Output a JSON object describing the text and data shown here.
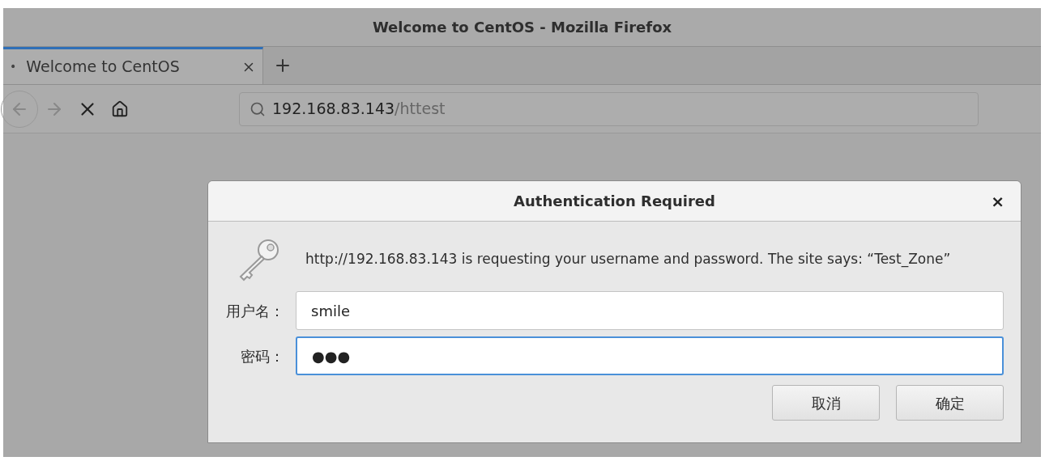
{
  "window": {
    "title": "Welcome to CentOS - Mozilla Firefox"
  },
  "tabs": [
    {
      "marker": "•",
      "label": "Welcome to CentOS",
      "selected": true
    }
  ],
  "address_bar": {
    "host": "192.168.83.143",
    "path": "/httest"
  },
  "dialog": {
    "title": "Authentication Required",
    "close": "×",
    "message": "http://192.168.83.143 is requesting your username and password. The site says: “Test_Zone”",
    "fields": [
      {
        "label": "用户名：",
        "value": "smile",
        "focused": false
      },
      {
        "label": "密码：",
        "value": "●●●",
        "focused": true
      }
    ],
    "buttons": [
      "取消",
      "确定"
    ]
  }
}
